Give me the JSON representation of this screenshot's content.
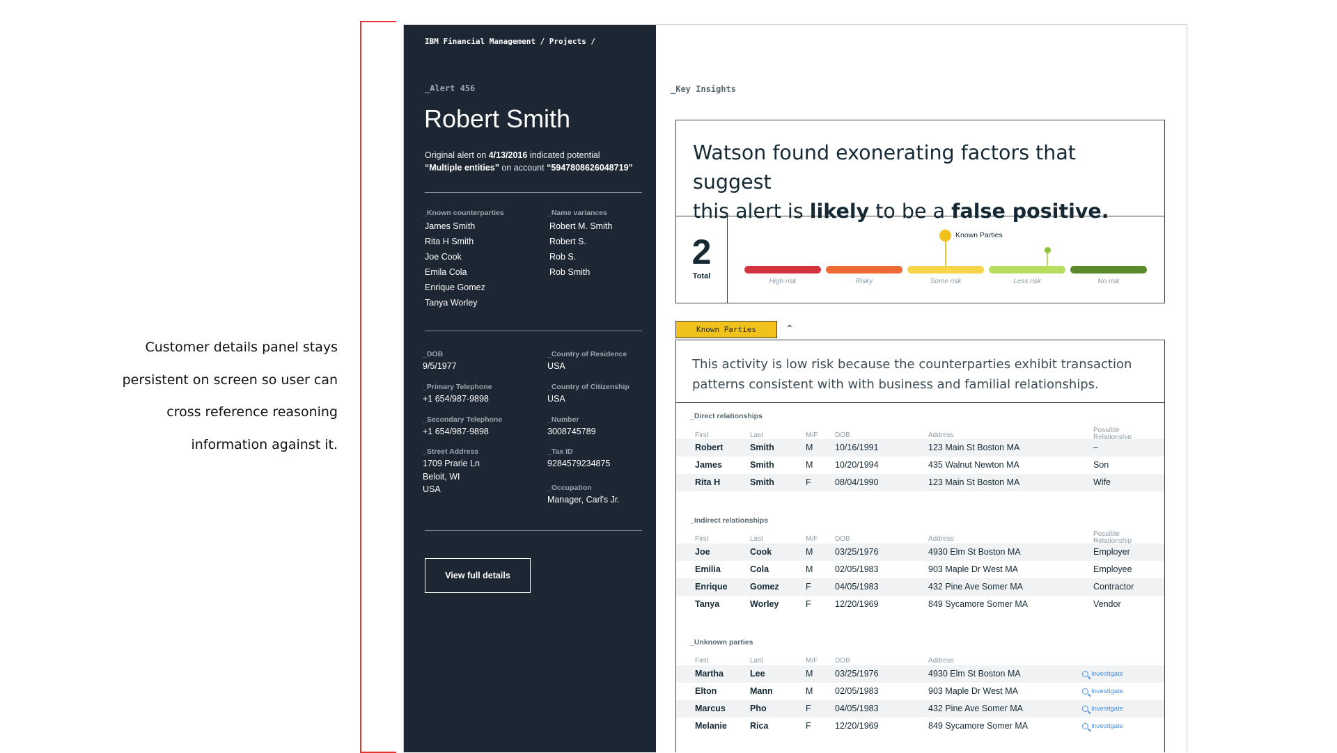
{
  "annotation": {
    "lines": [
      "Customer details panel stays",
      "persistent on screen so user can",
      "cross reference reasoning",
      "information against it."
    ]
  },
  "panel": {
    "breadcrumb": "IBM Financial Management / Projects /",
    "alert_id": "_Alert 456",
    "name": "Robert Smith",
    "orig_prefix": "Original alert on ",
    "orig_date": "4/13/2016",
    "orig_middle": " indicated potential",
    "orig_entities": "“Multiple entities”",
    "orig_on_account": " on account ",
    "orig_account": "“5947808626048719”",
    "known_counterparties_label": "_Known counterparties",
    "known_counterparties": [
      "James Smith",
      "Rita H Smith",
      "Joe Cook",
      "Emila Cola",
      "Enrique Gomez",
      "Tanya Worley"
    ],
    "name_variances_label": "_Name variances",
    "name_variances": [
      "Robert M. Smith",
      "Robert S.",
      "Rob S.",
      "Rob Smith"
    ],
    "fields_left": [
      {
        "label": "_DOB",
        "value": "9/5/1977"
      },
      {
        "label": "_Primary Telephone",
        "value": "+1 654/987-9898"
      },
      {
        "label": "_Secondary Telephone",
        "value": "+1 654/987-9898"
      },
      {
        "label": "_Street Address",
        "value": "1709 Prarie Ln",
        "value2": "Beloit, WI",
        "value3": "USA"
      }
    ],
    "fields_right": [
      {
        "label": "_Country of Residence",
        "value": "USA"
      },
      {
        "label": "_Country of Citizenship",
        "value": "USA"
      },
      {
        "label": "_Number",
        "value": "3008745789"
      },
      {
        "label": "_Tax ID",
        "value": "9284579234875"
      },
      {
        "label": "_Occupation",
        "value": "Manager, Carl's Jr."
      }
    ],
    "view_button": "View full details"
  },
  "insights": {
    "section_label": "_Key Insights",
    "headline_1": "Watson found exonerating factors that suggest",
    "headline_2a": "this alert is ",
    "headline_likely": "likely",
    "headline_2b": " to be a ",
    "headline_fp": "false positive.",
    "total_value": "2",
    "total_label": "Total",
    "risk_levels": [
      {
        "label": "High risk",
        "color": "#d3333f"
      },
      {
        "label": "Risky",
        "color": "#ee6a35"
      },
      {
        "label": "Some risk",
        "color": "#f7d54a"
      },
      {
        "label": "Less risk",
        "color": "#b8dc5d"
      },
      {
        "label": "No risk",
        "color": "#5a8a2a"
      }
    ],
    "marker_label": "Known Parties"
  },
  "known_parties": {
    "tab_label": "Known Parties",
    "explanation_1": "This activity is low risk because the counterparties exhibit transaction",
    "explanation_2": "patterns consistent with with business and familial relationships.",
    "columns": {
      "first": "First",
      "last": "Last",
      "mf": "M/F",
      "dob": "DOB",
      "address": "Address",
      "rel_1": "Possible",
      "rel_2": "Relationship"
    },
    "direct_label": "_Direct relationships",
    "direct": [
      {
        "first": "Robert",
        "last": "Smith",
        "mf": "M",
        "dob": "10/16/1991",
        "address": "123 Main St   Boston MA",
        "rel": "–"
      },
      {
        "first": "James",
        "last": "Smith",
        "mf": "M",
        "dob": "10/20/1994",
        "address": "435 Walnut    Newton MA",
        "rel": "Son"
      },
      {
        "first": "Rita H",
        "last": "Smith",
        "mf": "F",
        "dob": "08/04/1990",
        "address": "123 Main St      Boston MA",
        "rel": "Wife"
      }
    ],
    "indirect_label": "_Indirect relationships",
    "indirect": [
      {
        "first": "Joe",
        "last": "Cook",
        "mf": "M",
        "dob": "03/25/1976",
        "address": "4930 Elm St    Boston MA",
        "rel": "Employer"
      },
      {
        "first": "Emilia",
        "last": "Cola",
        "mf": "M",
        "dob": "02/05/1983",
        "address": "903 Maple Dr   West   MA",
        "rel": "Employee"
      },
      {
        "first": "Enrique",
        "last": "Gomez",
        "mf": "F",
        "dob": "04/05/1983",
        "address": "432 Pine Ave    Somer MA",
        "rel": "Contractor"
      },
      {
        "first": "Tanya",
        "last": "Worley",
        "mf": "F",
        "dob": "12/20/1969",
        "address": "849 Sycamore  Somer MA",
        "rel": "Vendor"
      }
    ],
    "unknown_label": "_Unknown parties",
    "unknown": [
      {
        "first": "Martha",
        "last": "Lee",
        "mf": "M",
        "dob": "03/25/1976",
        "address": "4930 Elm St    Boston MA"
      },
      {
        "first": "Elton",
        "last": "Mann",
        "mf": "M",
        "dob": "02/05/1983",
        "address": "903 Maple Dr   West   MA"
      },
      {
        "first": "Marcus",
        "last": "Pho",
        "mf": "F",
        "dob": "04/05/1983",
        "address": "432 Pine Ave    Somer MA"
      },
      {
        "first": "Melanie",
        "last": "Rica",
        "mf": "F",
        "dob": "12/20/1969",
        "address": "849 Sycamore  Somer MA"
      }
    ],
    "investigate_label": "Investigate"
  }
}
